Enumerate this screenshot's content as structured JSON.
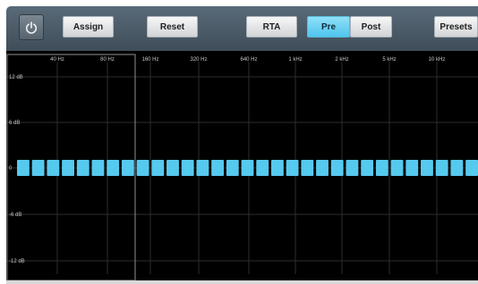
{
  "toolbar": {
    "assign_label": "Assign",
    "reset_label": "Reset",
    "rta_label": "RTA",
    "pre_label": "Pre",
    "post_label": "Post",
    "presets_label": "Presets",
    "active_mode": "Pre"
  },
  "graph": {
    "freq_labels": [
      "40 Hz",
      "80 Hz",
      "160 Hz",
      "320 Hz",
      "640 Hz",
      "1 kHz",
      "2 kHz",
      "5 kHz",
      "10 kHz"
    ],
    "db_labels": [
      "12 dB",
      "6 dB",
      "0",
      "-6 dB",
      "-12 dB"
    ],
    "band_count": 31,
    "band_gain_db": 0
  },
  "colors": {
    "accent": "#55c8ec",
    "band": "#56c9ee",
    "grid": "#2e2e2e",
    "background": "#000000"
  }
}
